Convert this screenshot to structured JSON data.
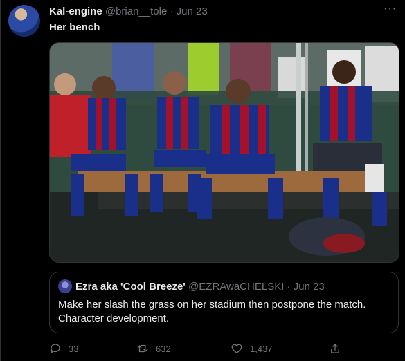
{
  "tweet": {
    "author_name": "Kal-engine",
    "handle": "@brian__tole",
    "separator": "·",
    "date": "Jun 23",
    "more_icon": "more-horizontal-icon",
    "text": "Her bench",
    "media": {
      "kind": "photo",
      "jersey_colors": [
        "#1a2f8a",
        "#a3122a",
        "#c8b400"
      ]
    }
  },
  "quote": {
    "author_name": "Ezra aka 'Cool Breeze'",
    "handle": "@EZRAwaCHELSKI",
    "separator": "·",
    "date": "Jun 23",
    "text": "Make her slash the grass on her stadium then postpone the match. Character development."
  },
  "actions": {
    "reply_count": "33",
    "retweet_count": "632",
    "like_count": "1,437"
  },
  "colors": {
    "background": "#000000",
    "text": "#e7e9ea",
    "muted": "#71767b",
    "border": "#2f3336"
  }
}
